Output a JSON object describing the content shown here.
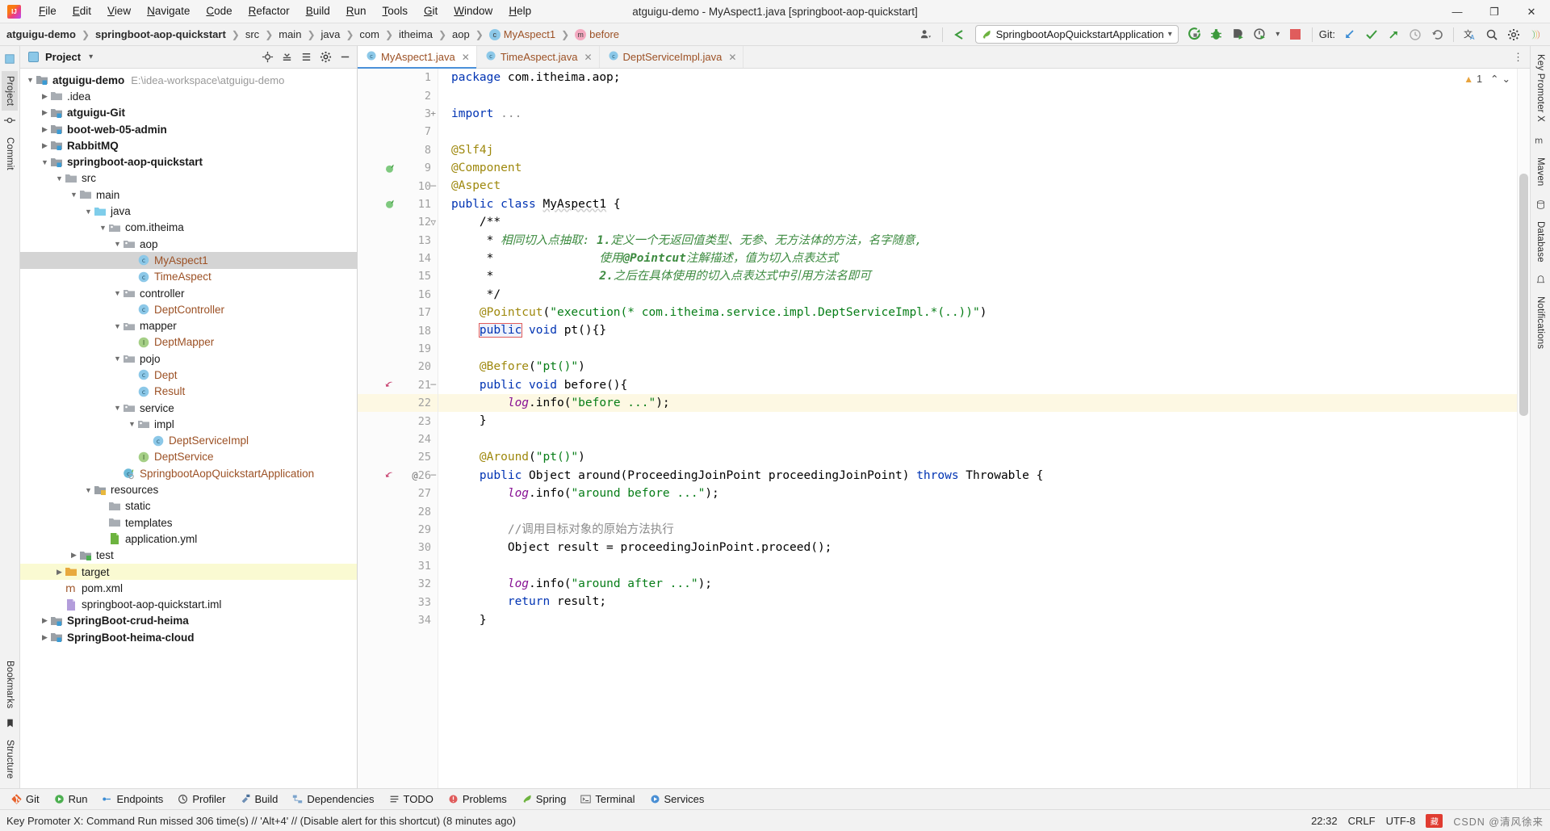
{
  "titlebar": {
    "window_title": "atguigu-demo - MyAspect1.java [springboot-aop-quickstart]",
    "logo_name": "intellij-idea-logo",
    "menus": [
      "File",
      "Edit",
      "View",
      "Navigate",
      "Code",
      "Refactor",
      "Build",
      "Run",
      "Tools",
      "Git",
      "Window",
      "Help"
    ],
    "minimize": "—",
    "maximize": "❐",
    "close": "✕"
  },
  "navbar": {
    "breadcrumbs": [
      {
        "label": "atguigu-demo",
        "style": "bold"
      },
      {
        "label": "springboot-aop-quickstart",
        "style": "bold"
      },
      {
        "label": "src",
        "style": "plain"
      },
      {
        "label": "main",
        "style": "plain"
      },
      {
        "label": "java",
        "style": "plain"
      },
      {
        "label": "com",
        "style": "plain"
      },
      {
        "label": "itheima",
        "style": "plain"
      },
      {
        "label": "aop",
        "style": "plain"
      },
      {
        "label": "MyAspect1",
        "style": "class"
      },
      {
        "label": "before",
        "style": "method"
      }
    ],
    "separator": "❯",
    "run_config": "SpringbootAopQuickstartApplication",
    "run_config_caret": "▾",
    "git_label": "Git:",
    "icons": {
      "user": "user-settings-icon",
      "back_arrow": "back-arrow-icon",
      "run": "run-icon",
      "debug": "debug-icon",
      "run_with_coverage": "run-coverage-icon",
      "profiler": "profiler-icon",
      "stop": "stop-icon",
      "update_project": "git-update-icon",
      "commit": "git-commit-icon",
      "push": "git-push-icon",
      "history": "git-history-icon",
      "rollback": "git-rollback-icon",
      "translate": "translate-icon",
      "search": "search-everywhere-icon",
      "settings": "settings-gear-icon",
      "ai_assistant": "ai-assistant-icon"
    }
  },
  "left_rail": {
    "items": [
      {
        "label": "Project",
        "active": true,
        "name": "rail-project"
      },
      {
        "label": "Commit",
        "active": false,
        "name": "rail-commit"
      }
    ],
    "bottom_items": [
      {
        "label": "Bookmarks",
        "name": "rail-bookmarks"
      },
      {
        "label": "Structure",
        "name": "rail-structure"
      }
    ]
  },
  "right_rail": {
    "items": [
      {
        "label": "Key Promoter X",
        "name": "rail-key-promoter-x"
      },
      {
        "label": "Maven",
        "name": "rail-maven"
      },
      {
        "label": "Database",
        "name": "rail-database"
      },
      {
        "label": "Notifications",
        "name": "rail-notifications"
      }
    ]
  },
  "project_panel": {
    "title": "Project",
    "caret": "▾",
    "toolbar_icons": [
      "locate-icon",
      "collapse-all-icon",
      "expand-icon",
      "settings-icon",
      "hide-icon"
    ],
    "tree": [
      {
        "depth": 0,
        "arrow": "open",
        "icon": "module-folder",
        "label": "atguigu-demo",
        "bold": true,
        "path": "E:\\idea-workspace\\atguigu-demo"
      },
      {
        "depth": 1,
        "arrow": "closed",
        "icon": "folder-gray",
        "label": ".idea",
        "bold": false
      },
      {
        "depth": 1,
        "arrow": "closed",
        "icon": "module-folder",
        "label": "atguigu-Git",
        "bold": true
      },
      {
        "depth": 1,
        "arrow": "closed",
        "icon": "module-folder",
        "label": "boot-web-05-admin",
        "bold": true
      },
      {
        "depth": 1,
        "arrow": "closed",
        "icon": "module-folder",
        "label": "RabbitMQ",
        "bold": true
      },
      {
        "depth": 1,
        "arrow": "open",
        "icon": "module-folder",
        "label": "springboot-aop-quickstart",
        "bold": true
      },
      {
        "depth": 2,
        "arrow": "open",
        "icon": "folder-gray",
        "label": "src",
        "bold": false
      },
      {
        "depth": 3,
        "arrow": "open",
        "icon": "folder-gray",
        "label": "main",
        "bold": false
      },
      {
        "depth": 4,
        "arrow": "open",
        "icon": "folder-source",
        "label": "java",
        "bold": false
      },
      {
        "depth": 5,
        "arrow": "open",
        "icon": "package",
        "label": "com.itheima",
        "bold": false
      },
      {
        "depth": 6,
        "arrow": "open",
        "icon": "package",
        "label": "aop",
        "bold": false
      },
      {
        "depth": 7,
        "arrow": "none",
        "icon": "class",
        "label": "MyAspect1",
        "kind": "class",
        "selected": true
      },
      {
        "depth": 7,
        "arrow": "none",
        "icon": "class",
        "label": "TimeAspect",
        "kind": "class"
      },
      {
        "depth": 6,
        "arrow": "open",
        "icon": "package",
        "label": "controller",
        "bold": false
      },
      {
        "depth": 7,
        "arrow": "none",
        "icon": "class",
        "label": "DeptController",
        "kind": "class"
      },
      {
        "depth": 6,
        "arrow": "open",
        "icon": "package",
        "label": "mapper",
        "bold": false
      },
      {
        "depth": 7,
        "arrow": "none",
        "icon": "interface",
        "label": "DeptMapper",
        "kind": "class"
      },
      {
        "depth": 6,
        "arrow": "open",
        "icon": "package",
        "label": "pojo",
        "bold": false
      },
      {
        "depth": 7,
        "arrow": "none",
        "icon": "class",
        "label": "Dept",
        "kind": "class"
      },
      {
        "depth": 7,
        "arrow": "none",
        "icon": "class",
        "label": "Result",
        "kind": "class"
      },
      {
        "depth": 6,
        "arrow": "open",
        "icon": "package",
        "label": "service",
        "bold": false
      },
      {
        "depth": 7,
        "arrow": "open",
        "icon": "package",
        "label": "impl",
        "bold": false
      },
      {
        "depth": 8,
        "arrow": "none",
        "icon": "class",
        "label": "DeptServiceImpl",
        "kind": "class"
      },
      {
        "depth": 7,
        "arrow": "none",
        "icon": "interface",
        "label": "DeptService",
        "kind": "class"
      },
      {
        "depth": 6,
        "arrow": "none",
        "icon": "spring-class",
        "label": "SpringbootAopQuickstartApplication",
        "kind": "class"
      },
      {
        "depth": 4,
        "arrow": "open",
        "icon": "folder-res",
        "label": "resources",
        "bold": false
      },
      {
        "depth": 5,
        "arrow": "none",
        "icon": "folder-gray",
        "label": "static",
        "bold": false
      },
      {
        "depth": 5,
        "arrow": "none",
        "icon": "folder-gray",
        "label": "templates",
        "bold": false
      },
      {
        "depth": 5,
        "arrow": "none",
        "icon": "yml-file",
        "label": "application.yml",
        "kind": "file"
      },
      {
        "depth": 3,
        "arrow": "closed",
        "icon": "folder-test",
        "label": "test",
        "bold": false
      },
      {
        "depth": 2,
        "arrow": "closed",
        "icon": "folder-target",
        "label": "target",
        "bold": false,
        "highlight": true
      },
      {
        "depth": 2,
        "arrow": "none",
        "icon": "maven-file",
        "label": "pom.xml",
        "kind": "file"
      },
      {
        "depth": 2,
        "arrow": "none",
        "icon": "iml-file",
        "label": "springboot-aop-quickstart.iml",
        "kind": "file"
      },
      {
        "depth": 1,
        "arrow": "closed",
        "icon": "module-folder",
        "label": "SpringBoot-crud-heima",
        "bold": true
      },
      {
        "depth": 1,
        "arrow": "closed",
        "icon": "module-folder",
        "label": "SpringBoot-heima-cloud",
        "bold": true
      }
    ]
  },
  "editor": {
    "tabs": [
      {
        "label": "MyAspect1.java",
        "active": true,
        "icon": "java-class-icon",
        "close": "✕"
      },
      {
        "label": "TimeAspect.java",
        "active": false,
        "icon": "java-class-icon",
        "close": "✕"
      },
      {
        "label": "DeptServiceImpl.java",
        "active": false,
        "icon": "java-class-icon",
        "close": "✕"
      }
    ],
    "more_icon": "⋮",
    "inspection": {
      "warning_count": "1",
      "warning_icon": "warning-triangle-icon",
      "up": "⌃",
      "down": "⌄"
    },
    "current_line": 22,
    "lines": [
      {
        "n": 1,
        "gutter": "",
        "fold": "",
        "html": "<span class=\"kw\">package</span> com.itheima.aop;"
      },
      {
        "n": 2,
        "gutter": "",
        "fold": "",
        "html": ""
      },
      {
        "n": 3,
        "gutter": "",
        "fold": "+",
        "html": "<span class=\"kw\">import</span> <span class=\"cmt\">...</span>"
      },
      {
        "n": 7,
        "gutter": "",
        "fold": "",
        "html": ""
      },
      {
        "n": 8,
        "gutter": "",
        "fold": "",
        "html": "<span class=\"ann\">@Slf4j</span>"
      },
      {
        "n": 9,
        "gutter": "spring",
        "fold": "",
        "html": "<span class=\"ann\">@Component</span>"
      },
      {
        "n": 10,
        "gutter": "",
        "fold": "─",
        "html": "<span class=\"ann\">@Aspect</span>"
      },
      {
        "n": 11,
        "gutter": "spring",
        "fold": "",
        "html": "<span class=\"kw\">public</span> <span class=\"kw\">class</span> <span class=\"cls-name\">MyAspect1</span> {"
      },
      {
        "n": 12,
        "gutter": "",
        "fold": "▽",
        "html": "    /**"
      },
      {
        "n": 13,
        "gutter": "",
        "fold": "",
        "html": "     * <span class=\"jdoc\">相同切入点抽取: <b>1.</b>定义一个无返回值类型、无参、无方法体的方法，名字随意,</span>"
      },
      {
        "n": 14,
        "gutter": "",
        "fold": "",
        "html": "     * <span class=\"jdoc\">              使用<b>@Pointcut</b>注解描述，值为切入点表达式</span>"
      },
      {
        "n": 15,
        "gutter": "",
        "fold": "",
        "html": "     * <span class=\"jdoc\">              <b>2.</b>之后在具体使用的切入点表达式中引用方法名即可</span>"
      },
      {
        "n": 16,
        "gutter": "",
        "fold": "",
        "html": "     */"
      },
      {
        "n": 17,
        "gutter": "",
        "fold": "",
        "html": "    <span class=\"ann\">@Pointcut</span>(<span class=\"str\">\"execution(* com.itheima.service.impl.DeptServiceImpl.*(..))\"</span>)"
      },
      {
        "n": 18,
        "gutter": "",
        "fold": "",
        "html": "    <span class=\"kw boxed\">public</span> <span class=\"kw\">void</span> pt(){}"
      },
      {
        "n": 19,
        "gutter": "",
        "fold": "",
        "html": ""
      },
      {
        "n": 20,
        "gutter": "",
        "fold": "",
        "html": "    <span class=\"ann\">@Before</span>(<span class=\"str\">\"pt()\"</span>)"
      },
      {
        "n": 21,
        "gutter": "advice",
        "fold": "─",
        "html": "    <span class=\"kw\">public</span> <span class=\"kw\">void</span> before(){"
      },
      {
        "n": 22,
        "gutter": "",
        "fold": "",
        "html": "        <span class=\"fld\">log</span>.info(<span class=\"str\">\"before ...\"</span>);"
      },
      {
        "n": 23,
        "gutter": "",
        "fold": "",
        "html": "    }"
      },
      {
        "n": 24,
        "gutter": "",
        "fold": "",
        "html": ""
      },
      {
        "n": 25,
        "gutter": "",
        "fold": "",
        "html": "    <span class=\"ann\">@Around</span>(<span class=\"str\">\"pt()\"</span>)"
      },
      {
        "n": 26,
        "gutter": "advice-at",
        "fold": "─",
        "html": "    <span class=\"kw\">public</span> Object around(ProceedingJoinPoint proceedingJoinPoint) <span class=\"kw\">throws</span> Throwable {"
      },
      {
        "n": 27,
        "gutter": "",
        "fold": "",
        "html": "        <span class=\"fld\">log</span>.info(<span class=\"str\">\"around before ...\"</span>);"
      },
      {
        "n": 28,
        "gutter": "",
        "fold": "",
        "html": ""
      },
      {
        "n": 29,
        "gutter": "",
        "fold": "",
        "html": "        <span class=\"cmt\">//调用目标对象的原始方法执行</span>"
      },
      {
        "n": 30,
        "gutter": "",
        "fold": "",
        "html": "        Object result = proceedingJoinPoint.proceed();"
      },
      {
        "n": 31,
        "gutter": "",
        "fold": "",
        "html": ""
      },
      {
        "n": 32,
        "gutter": "",
        "fold": "",
        "html": "        <span class=\"fld\">log</span>.info(<span class=\"str\">\"around after ...\"</span>);"
      },
      {
        "n": 33,
        "gutter": "",
        "fold": "",
        "html": "        <span class=\"kw\">return</span> result;"
      },
      {
        "n": 34,
        "gutter": "",
        "fold": "",
        "html": "    }"
      }
    ]
  },
  "bottom_toolbar": {
    "items": [
      {
        "label": "Git",
        "icon": "git-icon",
        "name": "tool-git"
      },
      {
        "label": "Run",
        "icon": "run-icon",
        "name": "tool-run"
      },
      {
        "label": "Endpoints",
        "icon": "endpoints-icon",
        "name": "tool-endpoints"
      },
      {
        "label": "Profiler",
        "icon": "profiler-icon",
        "name": "tool-profiler"
      },
      {
        "label": "Build",
        "icon": "build-icon",
        "name": "tool-build"
      },
      {
        "label": "Dependencies",
        "icon": "dependencies-icon",
        "name": "tool-dependencies"
      },
      {
        "label": "TODO",
        "icon": "todo-icon",
        "name": "tool-todo"
      },
      {
        "label": "Problems",
        "icon": "problems-icon",
        "name": "tool-problems"
      },
      {
        "label": "Spring",
        "icon": "spring-icon",
        "name": "tool-spring"
      },
      {
        "label": "Terminal",
        "icon": "terminal-icon",
        "name": "tool-terminal"
      },
      {
        "label": "Services",
        "icon": "services-icon",
        "name": "tool-services"
      }
    ]
  },
  "statusbar": {
    "message": "Key Promoter X: Command Run missed 306 time(s) // 'Alt+4' // (Disable alert for this shortcut) (8 minutes ago)",
    "caret_position": "22:32",
    "line_separator": "CRLF",
    "encoding": "UTF-8",
    "watermark": "CSDN @清风徐来"
  },
  "colors": {
    "accent_blue": "#4a90d9",
    "keyword": "#0033b3",
    "string": "#067d17",
    "annotation": "#9e880d",
    "class_orange": "#9c5125",
    "selection_gray": "#d4d4d4",
    "current_line": "#fdf8e3",
    "box_red": "#e05c5c"
  }
}
